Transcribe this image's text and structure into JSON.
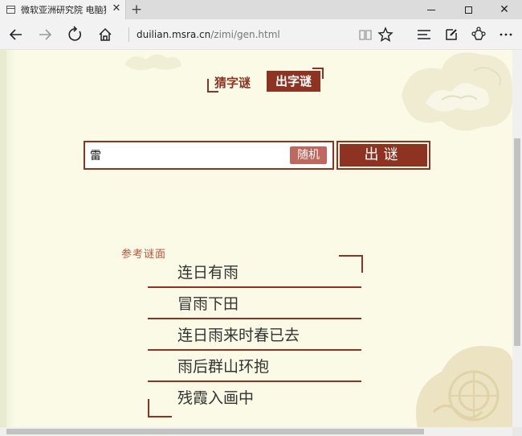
{
  "browser": {
    "tab_title": "微软亚洲研究院 电脑猜字谜",
    "tab_close": "✕",
    "new_tab": "+",
    "url_host": "duilian.msra.cn",
    "url_path": "/zimi/gen.html",
    "url_prefix": "",
    "close_glyph": "✕"
  },
  "page": {
    "tabs": {
      "guess": "猜字谜",
      "make": "出字谜"
    },
    "input": {
      "value": "雷"
    },
    "random_label": "随机",
    "submit_label": "出谜",
    "results": {
      "heading": "参考谜面",
      "items": [
        "连日有雨",
        "冒雨下田",
        "连日雨来时春已去",
        "雨后群山环抱",
        "残霞入画中"
      ]
    }
  },
  "colors": {
    "accent": "#8e3322",
    "random_button": "#c0675e",
    "heading": "#c0523c",
    "background": "#fafae6"
  }
}
